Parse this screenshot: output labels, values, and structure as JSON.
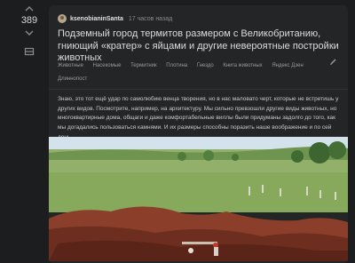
{
  "vote": {
    "score": "389"
  },
  "post": {
    "author": "ksenobianinSanta",
    "time": "17 часов назад",
    "title": "Подземный город термитов размером с Великобританию, гниющий «кратер» с яйцами и другие невероятные постройки животных",
    "tags": [
      "Животные",
      "Насекомые",
      "Термитник",
      "Плотина",
      "Гнездо",
      "Книга животных",
      "Яндекс Дзен",
      "Длиннопост"
    ],
    "body": "Знаю, это тот ещё удар по самолюбию венца творения, но в нас маловато черт, которые не встретишь у других видов. Посмотрите, например, на архитектуру. Мы сильно превзошли другие виды животных, но многоквартирные дома, общаги и даже комфортабельные виллы были придуманы задолго до того, как мы догадались пользоваться камнями. И их размеры способны поразить наше воображение и по сей день."
  },
  "colors": {
    "background": "#1c1d1f",
    "card": "#242527",
    "sky": "#cfe0ec",
    "field": "#7fa35a",
    "soil": "#8a3d2a"
  },
  "icons": [
    "arrow-up-icon",
    "arrow-down-icon",
    "bookmark-icon",
    "pencil-icon",
    "avatar"
  ]
}
